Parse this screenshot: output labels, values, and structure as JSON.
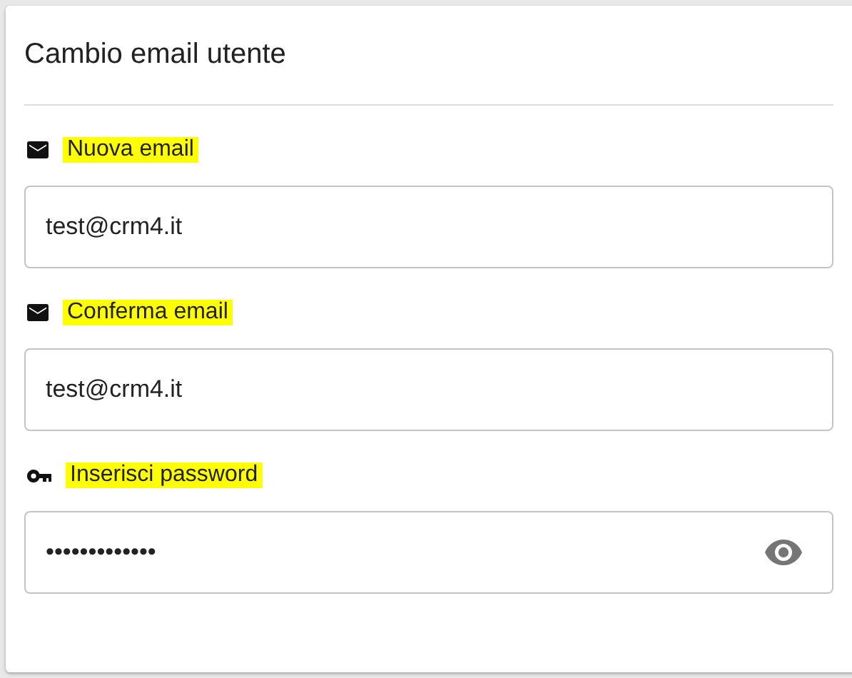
{
  "card": {
    "title": "Cambio email utente"
  },
  "fields": [
    {
      "kind": "email",
      "label": "Nuova email",
      "highlighted": true,
      "value": "test@crm4.it"
    },
    {
      "kind": "email",
      "label": "Conferma email",
      "highlighted": true,
      "value": "test@crm4.it"
    },
    {
      "kind": "password",
      "label": "Inserisci password",
      "highlighted": true,
      "value": "•••••••••••••"
    }
  ]
}
